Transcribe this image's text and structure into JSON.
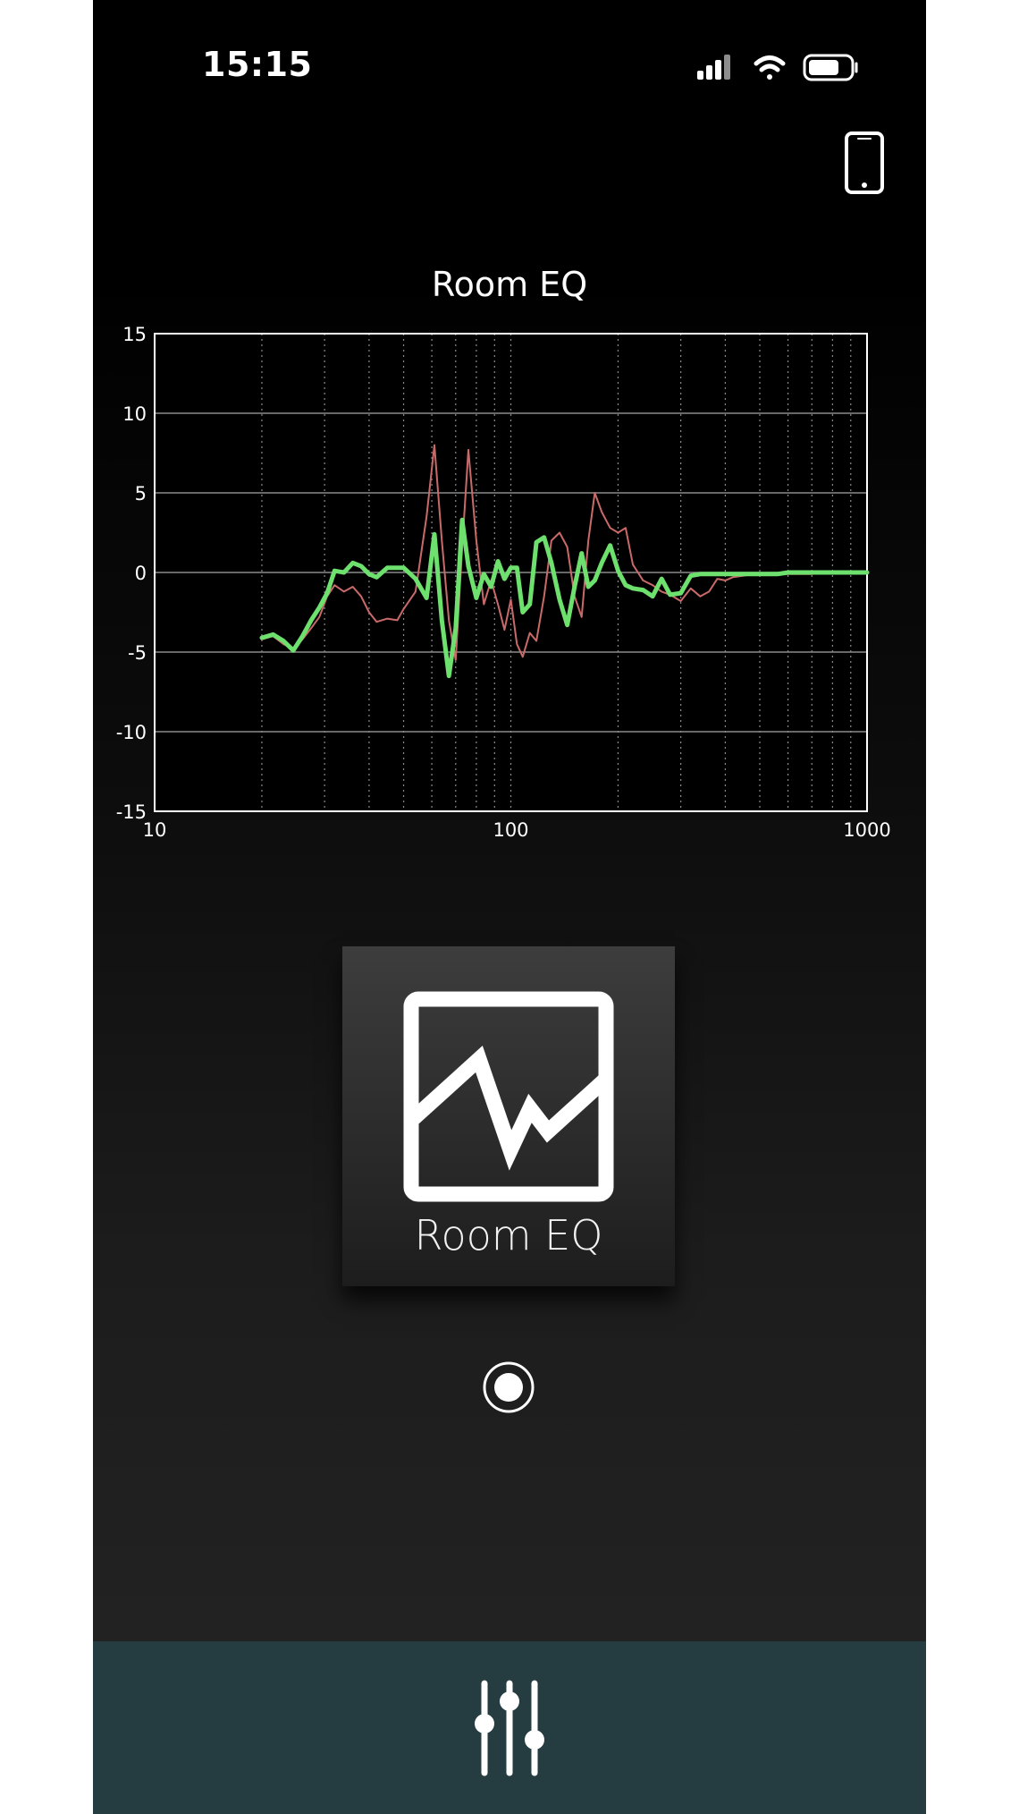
{
  "status_bar": {
    "time": "15:15",
    "icons": [
      "cellular-signal-icon",
      "wifi-icon",
      "battery-icon"
    ]
  },
  "header": {
    "device_button_icon": "smartphone-icon"
  },
  "chart_data": {
    "type": "line",
    "title": "Room EQ",
    "xlabel": "",
    "ylabel": "",
    "x_scale": "log",
    "xlim": [
      10,
      1000
    ],
    "ylim": [
      -15,
      15
    ],
    "x_ticks": [
      "10",
      "100",
      "1000"
    ],
    "y_ticks": [
      "15",
      "10",
      "5",
      "0",
      "-5",
      "-10",
      "-15"
    ],
    "grid": true,
    "colors": {
      "background": "#000000",
      "grid": "#8a8a8a",
      "series_corrected": "#6de06d",
      "series_measured": "#c96a6a"
    },
    "series": [
      {
        "x": [
          20,
          21.5,
          23,
          24.5,
          26,
          27.5,
          29,
          30.5,
          32,
          34,
          36,
          38,
          40,
          42,
          45,
          48,
          50,
          54,
          58,
          61,
          64,
          67,
          70,
          73,
          76,
          80,
          84,
          88,
          92,
          96,
          100,
          104,
          108,
          113,
          118,
          124,
          130,
          137,
          144,
          151,
          158,
          165,
          172,
          180,
          190,
          200,
          210,
          220,
          235,
          250,
          265,
          280,
          300,
          320,
          340,
          360,
          380,
          400,
          420,
          450,
          480,
          520,
          560,
          600,
          650,
          700,
          750,
          800,
          850,
          900,
          950,
          1000
        ],
        "values": [
          -4.2,
          -4.0,
          -4.5,
          -4.8,
          -4.2,
          -3.5,
          -2.8,
          -1.5,
          -0.8,
          -1.2,
          -0.9,
          -1.5,
          -2.5,
          -3.1,
          -2.9,
          -3.0,
          -2.3,
          -1.2,
          3.5,
          8.0,
          2.0,
          -3.0,
          -5.5,
          1.5,
          7.7,
          2.0,
          -2.0,
          -0.5,
          -2.0,
          -3.6,
          -1.7,
          -4.5,
          -5.3,
          -3.8,
          -4.3,
          -1.5,
          2.0,
          2.5,
          1.6,
          -1.5,
          -2.8,
          2.0,
          5.0,
          3.8,
          2.8,
          2.5,
          2.8,
          0.5,
          -0.5,
          -0.8,
          -1.2,
          -1.4,
          -1.8,
          -1.0,
          -1.5,
          -1.2,
          -0.4,
          -0.5,
          -0.3,
          -0.2,
          -0.1,
          -0.1,
          -0.1,
          -0.1,
          -0.1,
          -0.1,
          0,
          0,
          0,
          0,
          0,
          0
        ]
      },
      {
        "x": [
          20,
          21.5,
          23,
          24.5,
          26,
          27.5,
          29,
          30.5,
          32,
          34,
          36,
          38,
          40,
          42,
          45,
          48,
          50,
          54,
          58,
          61,
          64,
          67,
          70,
          73,
          76,
          80,
          84,
          88,
          92,
          96,
          100,
          104,
          108,
          113,
          118,
          124,
          130,
          137,
          144,
          151,
          158,
          165,
          172,
          180,
          190,
          200,
          210,
          220,
          235,
          250,
          265,
          280,
          300,
          320,
          340,
          360,
          380,
          400,
          420,
          450,
          480,
          520,
          560,
          600,
          650,
          700,
          750,
          800,
          850,
          900,
          950,
          1000
        ],
        "values": [
          -4.1,
          -3.9,
          -4.3,
          -4.9,
          -4.0,
          -3.0,
          -2.2,
          -1.3,
          0.1,
          0.0,
          0.6,
          0.4,
          -0.1,
          -0.3,
          0.3,
          0.3,
          0.3,
          -0.4,
          -1.6,
          2.4,
          -3.0,
          -6.5,
          -3.5,
          3.3,
          0.4,
          -1.6,
          -0.1,
          -0.9,
          0.7,
          -0.4,
          0.3,
          0.3,
          -2.5,
          -2.0,
          1.9,
          2.2,
          0.6,
          -1.7,
          -3.3,
          -0.9,
          1.2,
          -0.9,
          -0.5,
          0.6,
          1.7,
          0.1,
          -0.8,
          -1.0,
          -1.1,
          -1.5,
          -0.4,
          -1.4,
          -1.3,
          -0.2,
          -0.1,
          -0.1,
          -0.1,
          -0.1,
          -0.1,
          -0.1,
          -0.1,
          -0.1,
          -0.1,
          0,
          0,
          0,
          0,
          0,
          0,
          0,
          0,
          0
        ]
      }
    ]
  },
  "main_tile": {
    "label": "Room EQ",
    "icon": "room-eq-icon"
  },
  "page_indicator": {
    "pages": 1,
    "current": 1
  },
  "bottom_bar": {
    "icon": "mixer-sliders-icon"
  }
}
